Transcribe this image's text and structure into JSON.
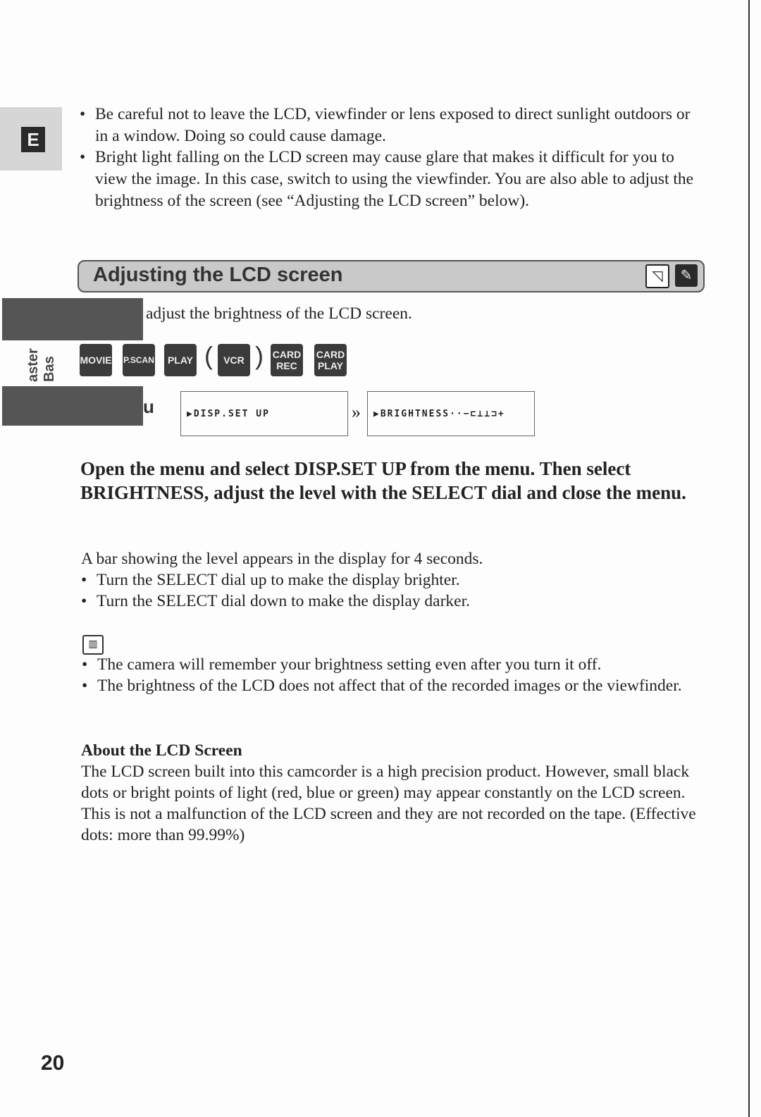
{
  "side_tab": "E",
  "top_bullets": [
    "Be careful not to leave the LCD, viewfinder or lens exposed to direct sunlight outdoors or in a window. Doing so could cause damage.",
    "Bright light falling on the LCD screen may cause glare that makes it difficult for you to view the image. In this case, switch to using the viewfinder. You are also able to adjust the brightness of the screen (see “Adjusting the LCD screen” below)."
  ],
  "section_title": "Adjusting the LCD screen",
  "section_icons": [
    "lcd-panel-icon",
    "remote-control-icon"
  ],
  "intro": "adjust the brightness of the LCD screen.",
  "side_label": "aster Bas",
  "side_menu_fragment": "u",
  "modes": [
    "MOVIE",
    "P.SCAN",
    "PLAY",
    "VCR",
    "CARD REC",
    "CARD PLAY"
  ],
  "menu_screens": [
    "▶DISP.SET UP",
    "▶BRIGHTNESS··−⊏⊥⊥⊐+"
  ],
  "instruction": "Open the menu and select DISP.SET UP from the menu. Then select BRIGHTNESS, adjust the level with the SELECT dial and close the menu.",
  "level_text": "A bar showing the level appears in the display for 4 seconds.",
  "level_bullets": [
    "Turn the SELECT dial up to make the display brighter.",
    "Turn the SELECT dial down to make the display darker."
  ],
  "note_icon": "memo-icon",
  "note_bullets": [
    "The camera will remember your brightness setting even after you turn it off.",
    "The brightness of the LCD does not affect that of the recorded images or the viewfinder."
  ],
  "about_title": "About the LCD Screen",
  "about_text": "The LCD screen built into this camcorder is a high precision product. However, small black dots or bright points of light (red, blue or green) may appear constantly on the LCD screen. This is not a malfunction of the LCD screen and they are not recorded on the tape. (Effective dots: more than 99.99%)",
  "page_number": "20"
}
